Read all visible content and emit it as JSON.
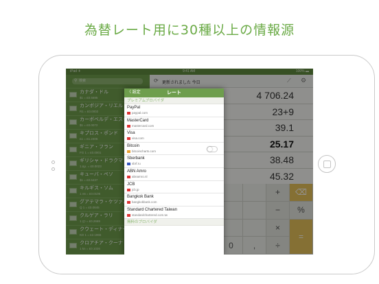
{
  "headline": "為替レート用に30種以上の情報源",
  "status": {
    "left": "iPad ✈",
    "time": "9:41 AM",
    "battery": "100% ▬"
  },
  "sidebar": {
    "search_placeholder": "検索",
    "currencies": [
      {
        "name": "カナダ・ドル",
        "rate": "$1 = £0.5695"
      },
      {
        "name": "カンボジア・リエル",
        "rate": "R1 = £0.0002"
      },
      {
        "name": "カーボベルデ・エスク",
        "rate": "$1 = £0.0072"
      },
      {
        "name": "キプロス・ポンド",
        "rate": "£1 = £1.2406"
      },
      {
        "name": "ギニア・フラン",
        "rate": "FG 1 = £0.0001"
      },
      {
        "name": "ギリシャ・ドラクマ",
        "rate": "1 Δρ. = £0.0023"
      },
      {
        "name": "キューバ・ペソ",
        "rate": "$1 = £0.6437"
      },
      {
        "name": "キルギス・ソム",
        "rate": "1 лв = £0.0106"
      },
      {
        "name": "グアテマラ・ケツァル",
        "rate": "Q 1 = £0.0845"
      },
      {
        "name": "クルゲア・ラリ",
        "rate": "1 ლ = £0.2669"
      },
      {
        "name": "クウェート・ディナー",
        "rate": "KD 1 = £2.1965"
      },
      {
        "name": "クロアチア・クーナ",
        "rate": "1 kn = £0.1026"
      }
    ]
  },
  "topbar": {
    "refresh_icon": "refresh-icon",
    "updated": "更新されました 今日",
    "chart_icon": "chart-icon",
    "settings_icon": "gear-icon"
  },
  "rows": [
    "4 706.24",
    "23+9",
    "39.1",
    "25.17",
    "38.48",
    "45.32"
  ],
  "keypad": {
    "plus": "+",
    "backspace": "⌫",
    "percent": "%",
    "minus": "−",
    "times": "×",
    "equals": "=",
    "double_zero": "00",
    "zero": "0",
    "dot": ",",
    "divide": "÷"
  },
  "popover": {
    "back": "〈 設定",
    "title": "レート",
    "section_premium": "プレミアムプロバイダ",
    "providers": [
      {
        "name": "PayPal",
        "url": "paypal.com"
      },
      {
        "name": "MasterCard",
        "url": "mastercard.com"
      },
      {
        "name": "Visa",
        "url": "visa.com"
      },
      {
        "name": "Bitcoin",
        "url": "bitcoincharts.com"
      },
      {
        "name": "Sberbank",
        "url": "sbrf.ru"
      },
      {
        "name": "ABN Amro",
        "url": "abnamro.nl"
      },
      {
        "name": "JCB",
        "url": "jcb.jp"
      },
      {
        "name": "Bangkok Bank",
        "url": "bangkokbank.com"
      },
      {
        "name": "Standard Chartered Taiwan",
        "url": "standardchartered.com.tw"
      }
    ],
    "section_free": "無料のプロバイダ"
  },
  "colors": {
    "accent": "#6e9e4d",
    "headline": "#6aaa45",
    "key_highlight": "#e6c15a"
  }
}
